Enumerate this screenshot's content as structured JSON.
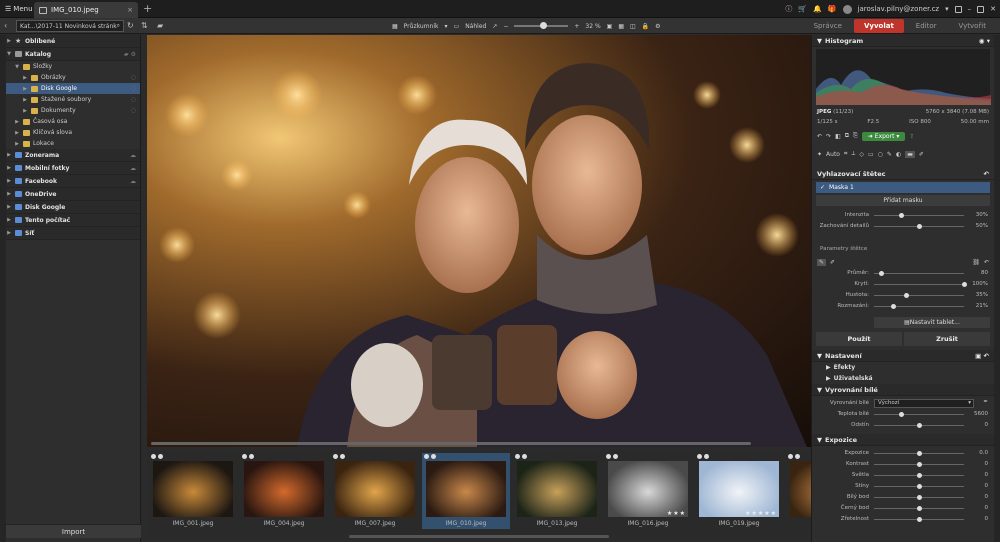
{
  "titlebar": {
    "menu_label": "Menu",
    "tab_label": "IMG_010.jpeg",
    "user_email": "jaroslav.pilny@zoner.cz"
  },
  "toolbar": {
    "path_text": "Kat...\\2017-11 Novinková stránka Q4",
    "browser_label": "Průzkumník",
    "preview_label": "Náhled",
    "zoom_text": "32 %",
    "zoom_fraction": 0.32
  },
  "modes": [
    {
      "label": "Správce",
      "active": false
    },
    {
      "label": "Vyvolat",
      "active": true
    },
    {
      "label": "Editor",
      "active": false
    },
    {
      "label": "Vytvořit",
      "active": false
    }
  ],
  "sidebar": {
    "sections": [
      {
        "label": "Oblíbené"
      },
      {
        "label": "Katalog"
      }
    ],
    "catalog_items": [
      {
        "label": "Složky",
        "level": 1
      },
      {
        "label": "Obrázky",
        "level": 2
      },
      {
        "label": "Disk Google",
        "level": 2,
        "selected": true
      },
      {
        "label": "Stažené soubory",
        "level": 2
      },
      {
        "label": "Dokumenty",
        "level": 2
      },
      {
        "label": "Časová osa",
        "level": 1
      },
      {
        "label": "Klíčová slova",
        "level": 1
      },
      {
        "label": "Lokace",
        "level": 1
      }
    ],
    "bottom_sections": [
      {
        "label": "Zonerama"
      },
      {
        "label": "Mobilní fotky"
      },
      {
        "label": "Facebook"
      },
      {
        "label": "OneDrive"
      },
      {
        "label": "Disk Google"
      },
      {
        "label": "Tento počítač"
      },
      {
        "label": "Síť"
      }
    ],
    "import_label": "Import"
  },
  "filmstrip": [
    {
      "name": "IMG_001.jpeg",
      "colors": [
        "#1d1712",
        "#c98a3a"
      ],
      "stars": ""
    },
    {
      "name": "IMG_004.jpeg",
      "colors": [
        "#2a1610",
        "#d36a2c"
      ],
      "stars": ""
    },
    {
      "name": "IMG_007.jpeg",
      "colors": [
        "#3a2410",
        "#e2a54a"
      ],
      "stars": ""
    },
    {
      "name": "IMG_010.jpeg",
      "colors": [
        "#2a1a12",
        "#c9884a"
      ],
      "stars": "",
      "selected": true
    },
    {
      "name": "IMG_013.jpeg",
      "colors": [
        "#1c2418",
        "#c7a05a"
      ],
      "stars": ""
    },
    {
      "name": "IMG_016.jpeg",
      "colors": [
        "#4a4a4a",
        "#d8d8d8"
      ],
      "stars": "★★★"
    },
    {
      "name": "IMG_019.jpeg",
      "colors": [
        "#9fb7d4",
        "#f1f3f7"
      ],
      "stars": "★★★★★"
    },
    {
      "name": "",
      "colors": [
        "#3a2410",
        "#c9884a"
      ],
      "stars": ""
    }
  ],
  "right_panel": {
    "histogram_label": "Histogram",
    "file_type": "JPEG",
    "file_index": "(11/23)",
    "dimensions": "5760 x 3840 (7.08 MB)",
    "shutter": "1/125 s",
    "aperture": "F2.5",
    "iso": "ISO 800",
    "focal": "50.00 mm",
    "export_label": "Export",
    "auto_label": "Auto",
    "brush_title": "Vyhlazovací štětec",
    "mask_label": "Maska 1",
    "add_mask_label": "Přidat masku",
    "brush_params_label": "Parametry štětce",
    "tablet_label": "Nastavit tablet...",
    "apply_label": "Použít",
    "cancel_label": "Zrušit",
    "settings_label": "Nastavení",
    "effects_label": "Efekty",
    "user_label": "Uživatelská",
    "wb_label": "Vyrovnání bílé",
    "wb_select_label": "Vyrovnání bílé",
    "wb_select_value": "Výchozí",
    "exposure_label": "Expozice",
    "top_params": [
      {
        "label": "Intenzita",
        "value": "30%",
        "level": 0.3
      },
      {
        "label": "Zachování detailů",
        "value": "50%",
        "level": 0.5
      }
    ],
    "brush_params": [
      {
        "label": "Průměr:",
        "value": "80",
        "level": 0.08
      },
      {
        "label": "Krytí:",
        "value": "100%",
        "level": 1.0
      },
      {
        "label": "Hustota:",
        "value": "35%",
        "level": 0.35
      },
      {
        "label": "Rozmazání:",
        "value": "21%",
        "level": 0.21
      }
    ],
    "wb_params": [
      {
        "label": "Teplota bílé",
        "value": "5600",
        "level": 0.3
      },
      {
        "label": "Odstín",
        "value": "0",
        "level": 0.5
      }
    ],
    "exposure_params": [
      {
        "label": "Expozice",
        "value": "0.0",
        "level": 0.5
      },
      {
        "label": "Kontrast",
        "value": "0",
        "level": 0.5
      },
      {
        "label": "Světla",
        "value": "0",
        "level": 0.5
      },
      {
        "label": "Stíny",
        "value": "0",
        "level": 0.5
      },
      {
        "label": "Bílý bod",
        "value": "0",
        "level": 0.5
      },
      {
        "label": "Černý bod",
        "value": "0",
        "level": 0.5
      },
      {
        "label": "Zřetelnost",
        "value": "0",
        "level": 0.5
      }
    ]
  }
}
